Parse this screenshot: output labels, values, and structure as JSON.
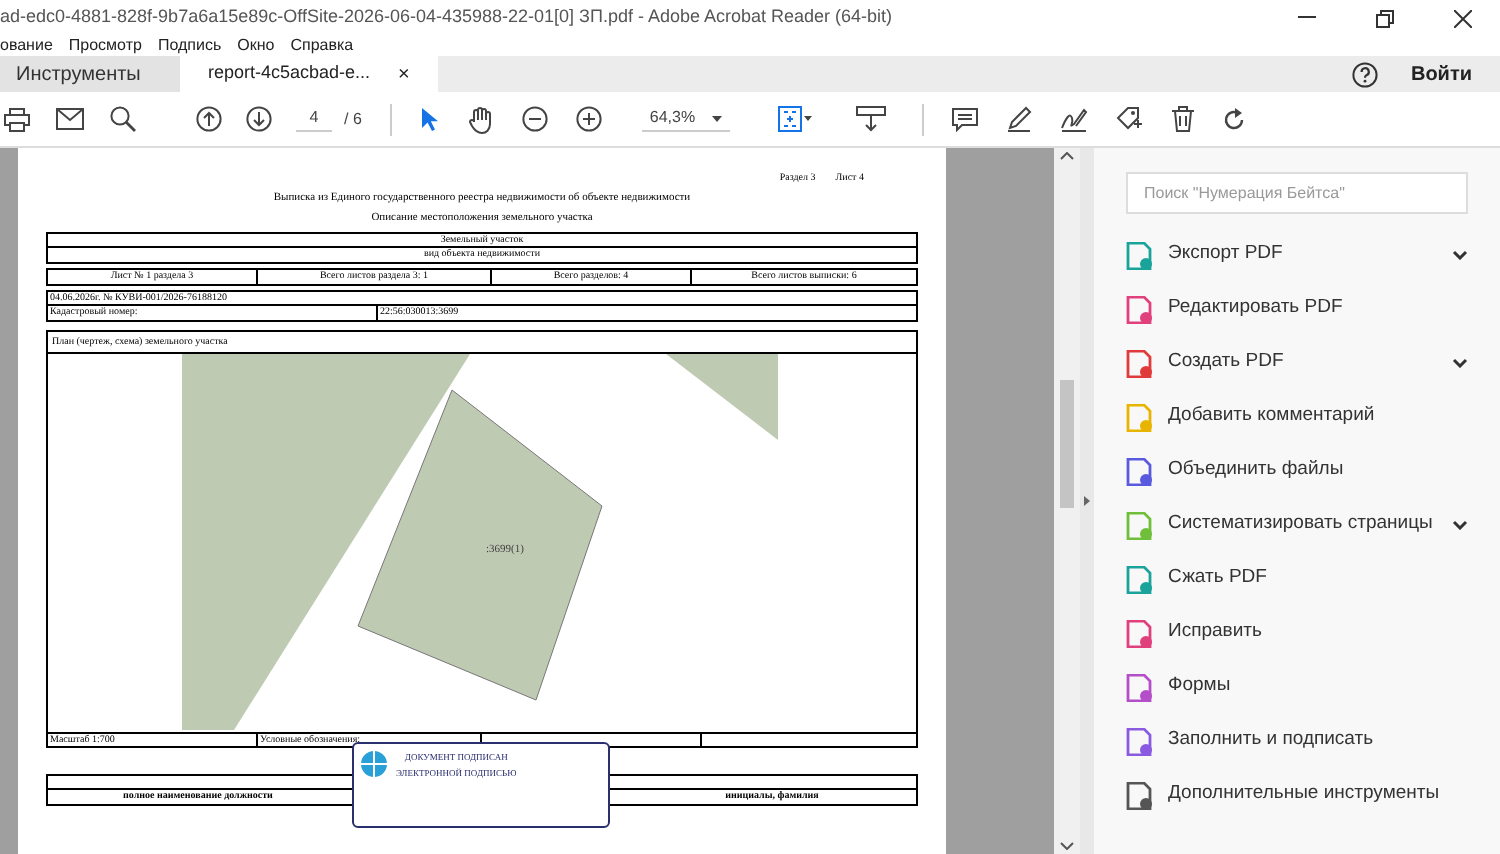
{
  "window": {
    "title": "ad-edc0-4881-828f-9b7a6a15e89c-OffSite-2026-06-04-435988-22-01[0] ЗП.pdf - Adobe Acrobat Reader (64-bit)"
  },
  "menu": [
    "ование",
    "Просмотр",
    "Подпись",
    "Окно",
    "Справка"
  ],
  "tabs": [
    {
      "label": "Инструменты",
      "selected": false,
      "closable": false
    },
    {
      "label": "report-4c5acbad-e...",
      "selected": true,
      "closable": true
    }
  ],
  "close_glyph": "×",
  "sign_in": "Войти",
  "toolbar": {
    "page": "4",
    "page_total": "/ 6",
    "zoom": "64,3%"
  },
  "document": {
    "section": "Раздел 3",
    "sheet": "Лист 4",
    "title": "Выписка из Единого государственного реестра недвижимости об объекте недвижимости",
    "subtitle": "Описание местоположения земельного участка",
    "object": "Земельный участок",
    "object_caption": "вид объекта недвижимости",
    "counts": [
      "Лист № 1 раздела 3",
      "Всего листов раздела 3: 1",
      "Всего разделов: 4",
      "Всего листов выписки: 6"
    ],
    "reference": "04.06.2026г. № КУВИ-001/2026-76188120",
    "cadastral_label": "Кадастровый номер:",
    "cadastral_number": "22:56:030013:3699",
    "plan_title": "План (чертеж, схема) земельного участка",
    "parcel_label": ":3699(1)",
    "scale": "Масштаб 1:700",
    "legend": "Условные обозначения:",
    "stamp": [
      "ДОКУМЕНТ ПОДПИСАН",
      "ЭЛЕКТРОННОЙ ПОДПИСЬЮ"
    ],
    "position_caption": "полное наименование должности",
    "name_caption": "инициалы, фамилия"
  },
  "tools_panel": {
    "search_placeholder": "Поиск \"Нумерация Бейтса\"",
    "items": [
      {
        "label": "Экспорт PDF",
        "color": "#1aa39a",
        "expandable": true
      },
      {
        "label": "Редактировать PDF",
        "color": "#e0407b",
        "expandable": false
      },
      {
        "label": "Создать PDF",
        "color": "#e03a3a",
        "expandable": true
      },
      {
        "label": "Добавить комментарий",
        "color": "#e8b400",
        "expandable": false
      },
      {
        "label": "Объединить файлы",
        "color": "#5a5adf",
        "expandable": false
      },
      {
        "label": "Систематизировать страницы",
        "color": "#6fbf3a",
        "expandable": true
      },
      {
        "label": "Сжать PDF",
        "color": "#1aa39a",
        "expandable": false
      },
      {
        "label": "Исправить",
        "color": "#e0407b",
        "expandable": false
      },
      {
        "label": "Формы",
        "color": "#b54fc9",
        "expandable": false
      },
      {
        "label": "Заполнить и подписать",
        "color": "#8a5ae0",
        "expandable": false
      },
      {
        "label": "Дополнительные инструменты",
        "color": "#555555",
        "expandable": false
      }
    ]
  }
}
